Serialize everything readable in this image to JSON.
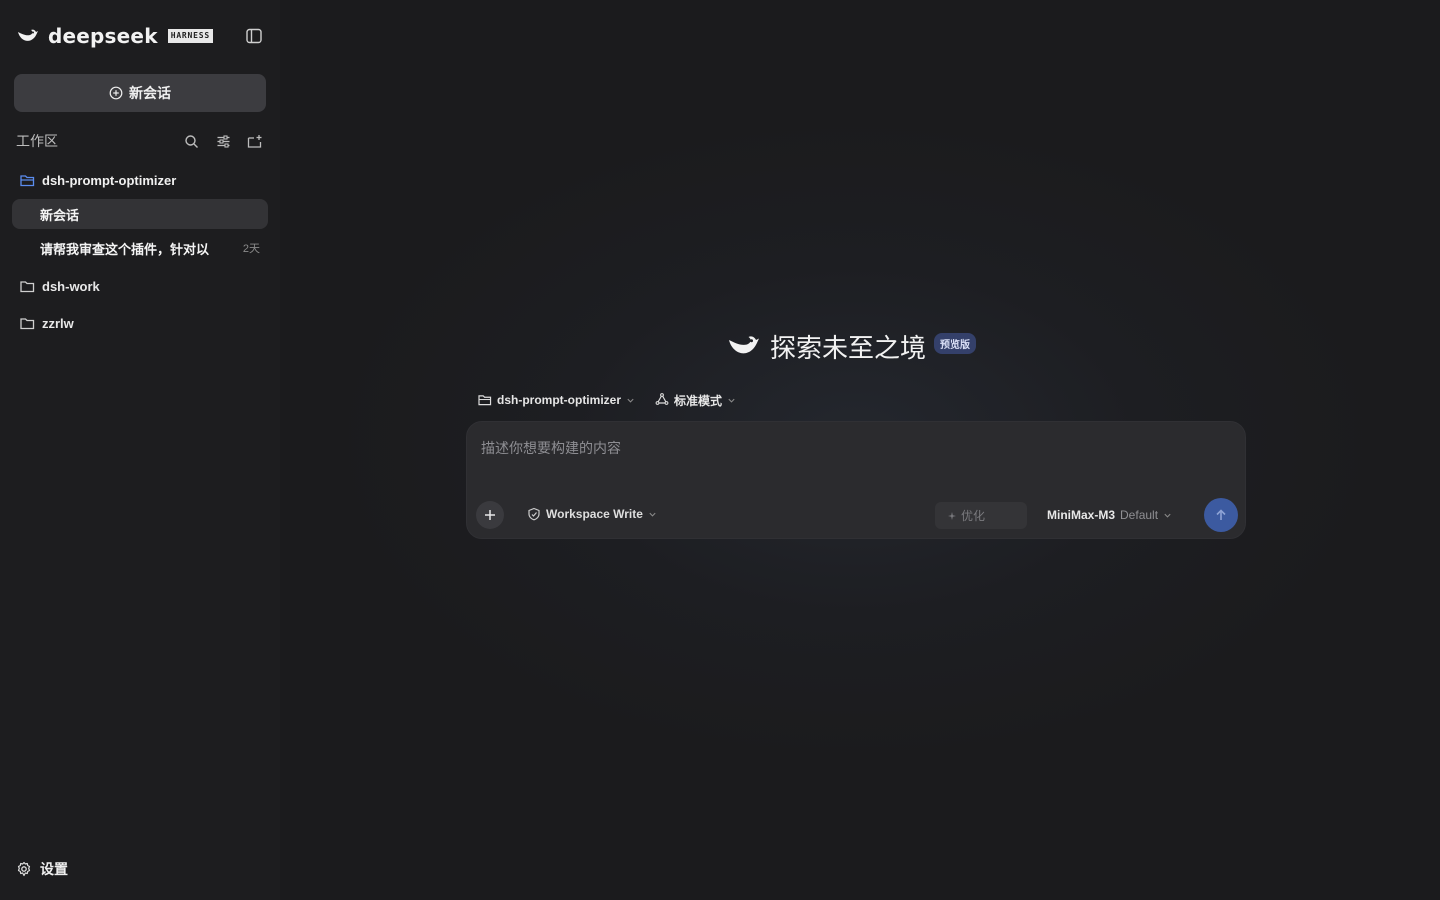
{
  "brand": {
    "name": "deepseek",
    "badge": "HARNESS"
  },
  "sidebar": {
    "new_chat_label": "新会话",
    "workspace_title": "工作区",
    "tools": [
      "search-icon",
      "filter-icon",
      "new-folder-icon"
    ],
    "folders": [
      {
        "name": "dsh-prompt-optimizer",
        "expanded": true
      },
      {
        "name": "dsh-work",
        "expanded": false
      },
      {
        "name": "zzrlw",
        "expanded": false
      }
    ],
    "chats": [
      {
        "title": "新会话",
        "age": "",
        "active": true
      },
      {
        "title": "请帮我审查这个插件，针对以",
        "age": "2天",
        "active": false
      }
    ],
    "settings_label": "设置"
  },
  "main": {
    "hero_title": "探索未至之境",
    "hero_badge": "预览版",
    "workspace_selector": "dsh-prompt-optimizer",
    "mode_selector": "标准模式",
    "composer": {
      "placeholder": "描述你想要构建的内容",
      "permission": "Workspace Write",
      "optimize_label": "优化",
      "model_name": "MiniMax-M3",
      "model_tag": "Default"
    }
  },
  "colors": {
    "accent": "#3c5aa0",
    "badge_bg": "#34406a",
    "folder_blue": "#5b8def"
  }
}
